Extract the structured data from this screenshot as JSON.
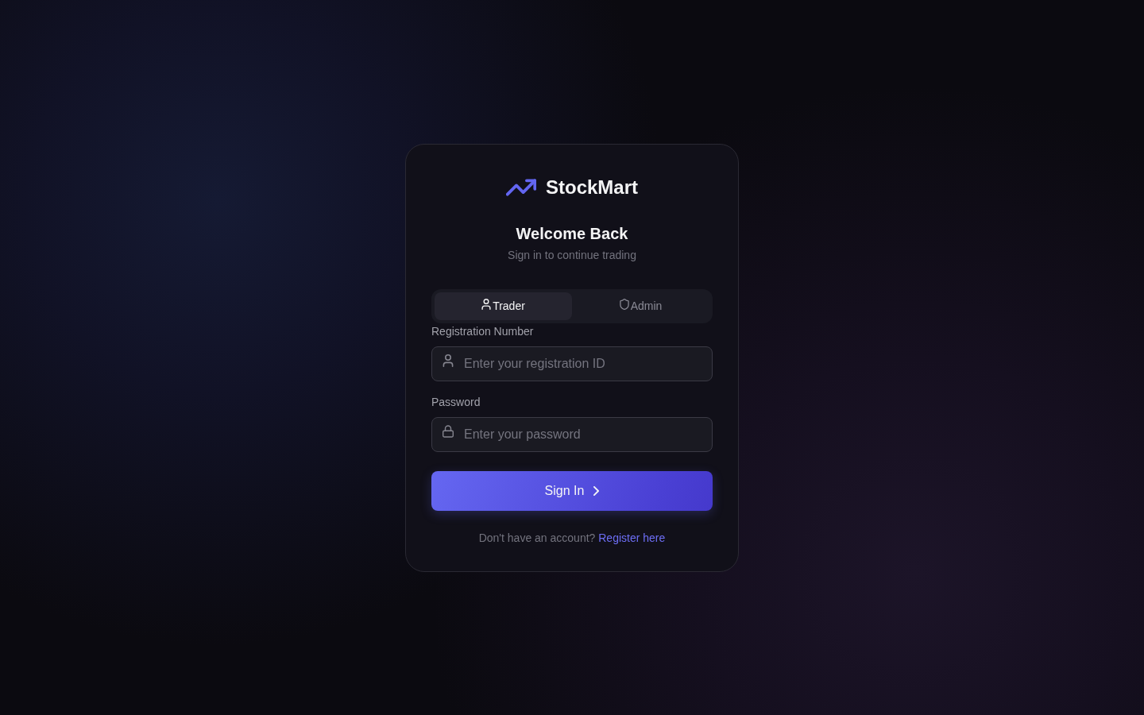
{
  "brand": {
    "name": "StockMart"
  },
  "heading": {
    "title": "Welcome Back",
    "subtitle": "Sign in to continue trading"
  },
  "tabs": [
    {
      "label": "Trader",
      "selected": true
    },
    {
      "label": "Admin",
      "selected": false
    }
  ],
  "fields": [
    {
      "label": "Registration Number",
      "placeholder": "Enter your registration ID"
    },
    {
      "label": "Password",
      "placeholder": "Enter your password"
    }
  ],
  "submit": {
    "label": "Sign In"
  },
  "footer": {
    "text": "Don't have an account?",
    "link": "Register here"
  }
}
